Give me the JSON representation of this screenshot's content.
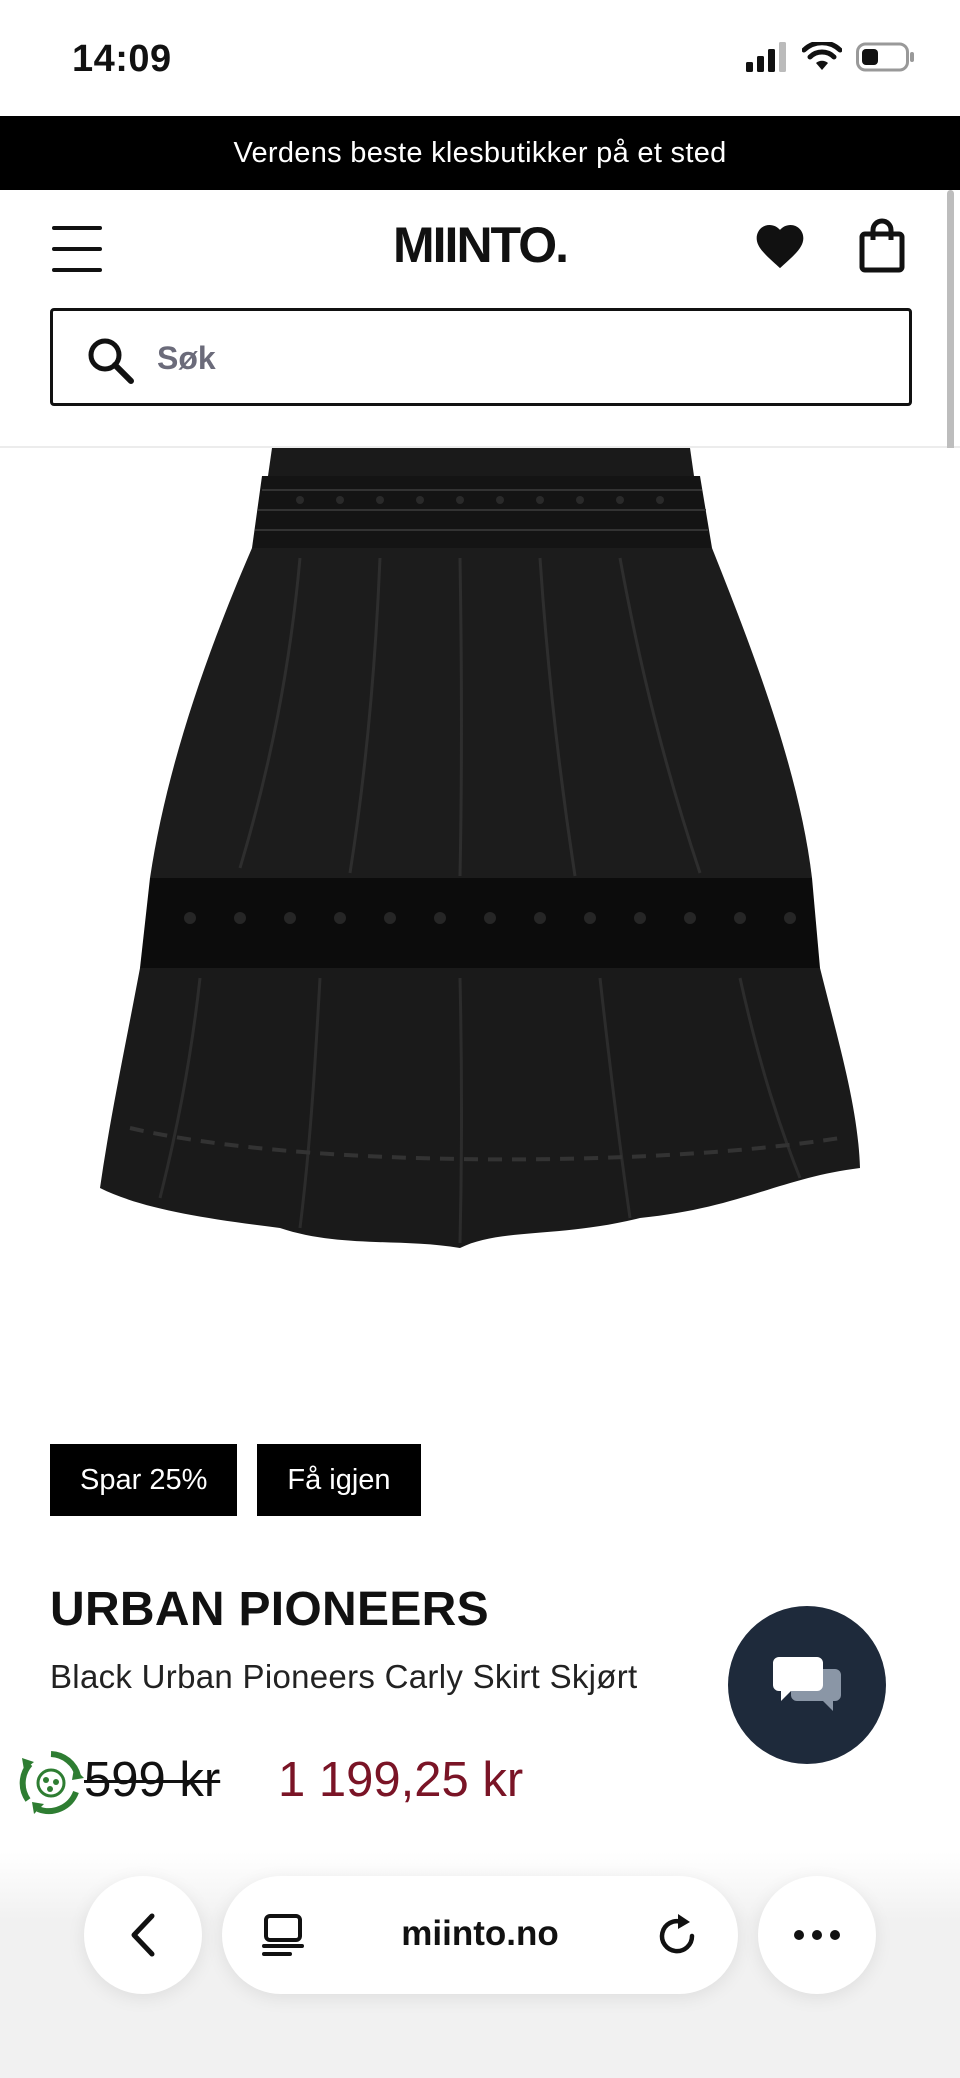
{
  "status_bar": {
    "time": "14:09"
  },
  "promo_banner": {
    "text": "Verdens beste klesbutikker på et sted"
  },
  "header": {
    "logo": "MIINTO.",
    "search_placeholder": "Søk"
  },
  "product": {
    "badges": [
      "Spar 25%",
      "Få igjen"
    ],
    "brand": "URBAN PIONEERS",
    "name": "Black Urban Pioneers Carly Skirt Skjørt",
    "price_old": "599 kr",
    "price_new": "1 199,25 kr"
  },
  "browser": {
    "url": "miinto.no"
  },
  "colors": {
    "accent": "#000000",
    "price_sale": "#7a1426",
    "chat_button": "#1e2a3b"
  },
  "icons": {
    "menu": "hamburger-icon",
    "wishlist": "heart-icon",
    "cart": "shopping-bag-icon",
    "search": "search-icon",
    "chat": "chat-bubbles-icon",
    "eco": "recycle-icon",
    "back": "chevron-left-icon",
    "tabs": "tab-overview-icon",
    "reload": "reload-icon",
    "more": "more-icon"
  }
}
